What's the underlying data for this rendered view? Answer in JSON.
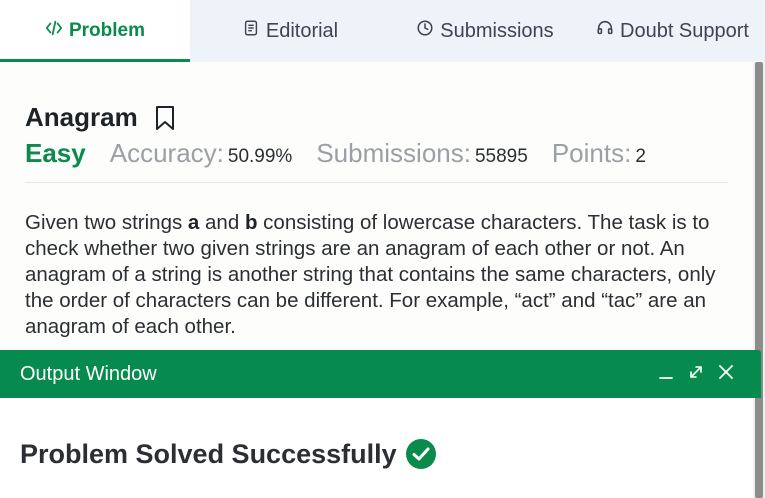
{
  "tabs": [
    {
      "label": "Problem",
      "icon": "code-icon",
      "active": true
    },
    {
      "label": "Editorial",
      "icon": "document-icon",
      "active": false
    },
    {
      "label": "Submissions",
      "icon": "clock-icon",
      "active": false
    },
    {
      "label": "Doubt Support",
      "icon": "headset-icon",
      "active": false
    }
  ],
  "problem": {
    "title": "Anagram",
    "difficulty": "Easy",
    "accuracy_label": "Accuracy:",
    "accuracy_value": "50.99%",
    "submissions_label": "Submissions:",
    "submissions_value": "55895",
    "points_label": "Points:",
    "points_value": "2",
    "description": {
      "part1": "Given two strings ",
      "var_a": "a",
      "part2": " and ",
      "var_b": "b",
      "part3": " consisting of lowercase characters. The task is to check whether two given strings are an anagram of each other or not. An anagram of a string is another string that contains the same characters, only the order of characters can be different. For example, “act” and “tac” are an anagram of each other."
    }
  },
  "output_window": {
    "title": "Output Window",
    "message": "Problem Solved Successfully"
  },
  "colors": {
    "accent": "#0b8b4b",
    "output_header": "#078a4d",
    "tab_bar": "#eef3f9"
  }
}
